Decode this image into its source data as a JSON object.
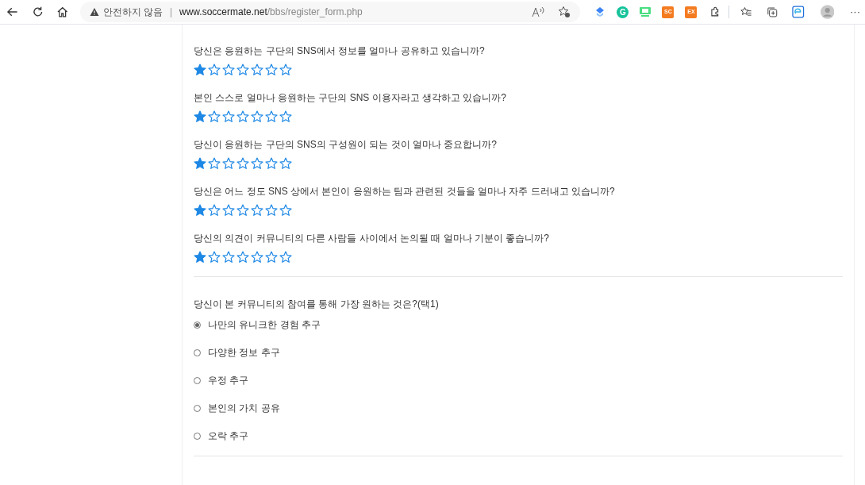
{
  "browser": {
    "security_label": "안전하지 않음",
    "separator": "|",
    "url_host": "www.soccermate.net",
    "url_path": "/bbs/register_form.php",
    "extensions": [
      {
        "kind": "shape"
      },
      {
        "kind": "grammar",
        "label": "G"
      },
      {
        "kind": "screen"
      },
      {
        "kind": "text",
        "label": "SC"
      },
      {
        "kind": "text",
        "label": "EX"
      }
    ],
    "more": "···"
  },
  "ratings": [
    {
      "question": "당신은 응원하는 구단의 SNS에서 정보를 얼마나 공유하고 있습니까?",
      "stars": 1
    },
    {
      "question": "본인 스스로 얼마나 응원하는 구단의 SNS 이용자라고 생각하고 있습니까?",
      "stars": 1
    },
    {
      "question": "당신이 응원하는 구단의 SNS의 구성원이 되는 것이 얼마나 중요합니까?",
      "stars": 1
    },
    {
      "question": "당신은 어느 정도 SNS 상에서 본인이 응원하는 팀과 관련된 것들을 얼마나 자주 드러내고 있습니까?",
      "stars": 1
    },
    {
      "question": "당신의 의견이 커뮤니티의 다른 사람들 사이에서 논의될 때 얼마나 기분이 좋습니까?",
      "stars": 1
    }
  ],
  "choice": {
    "question": "당신이 본 커뮤니티의 참여를 통해 가장 원하는 것은?(택1)",
    "options": [
      {
        "label": "나만의 유니크한 경험 추구",
        "selected": true
      },
      {
        "label": "다양한 정보 추구",
        "selected": false
      },
      {
        "label": "우정 추구",
        "selected": false
      },
      {
        "label": "본인의 가치 공유",
        "selected": false
      },
      {
        "label": "오락 추구",
        "selected": false
      }
    ]
  }
}
